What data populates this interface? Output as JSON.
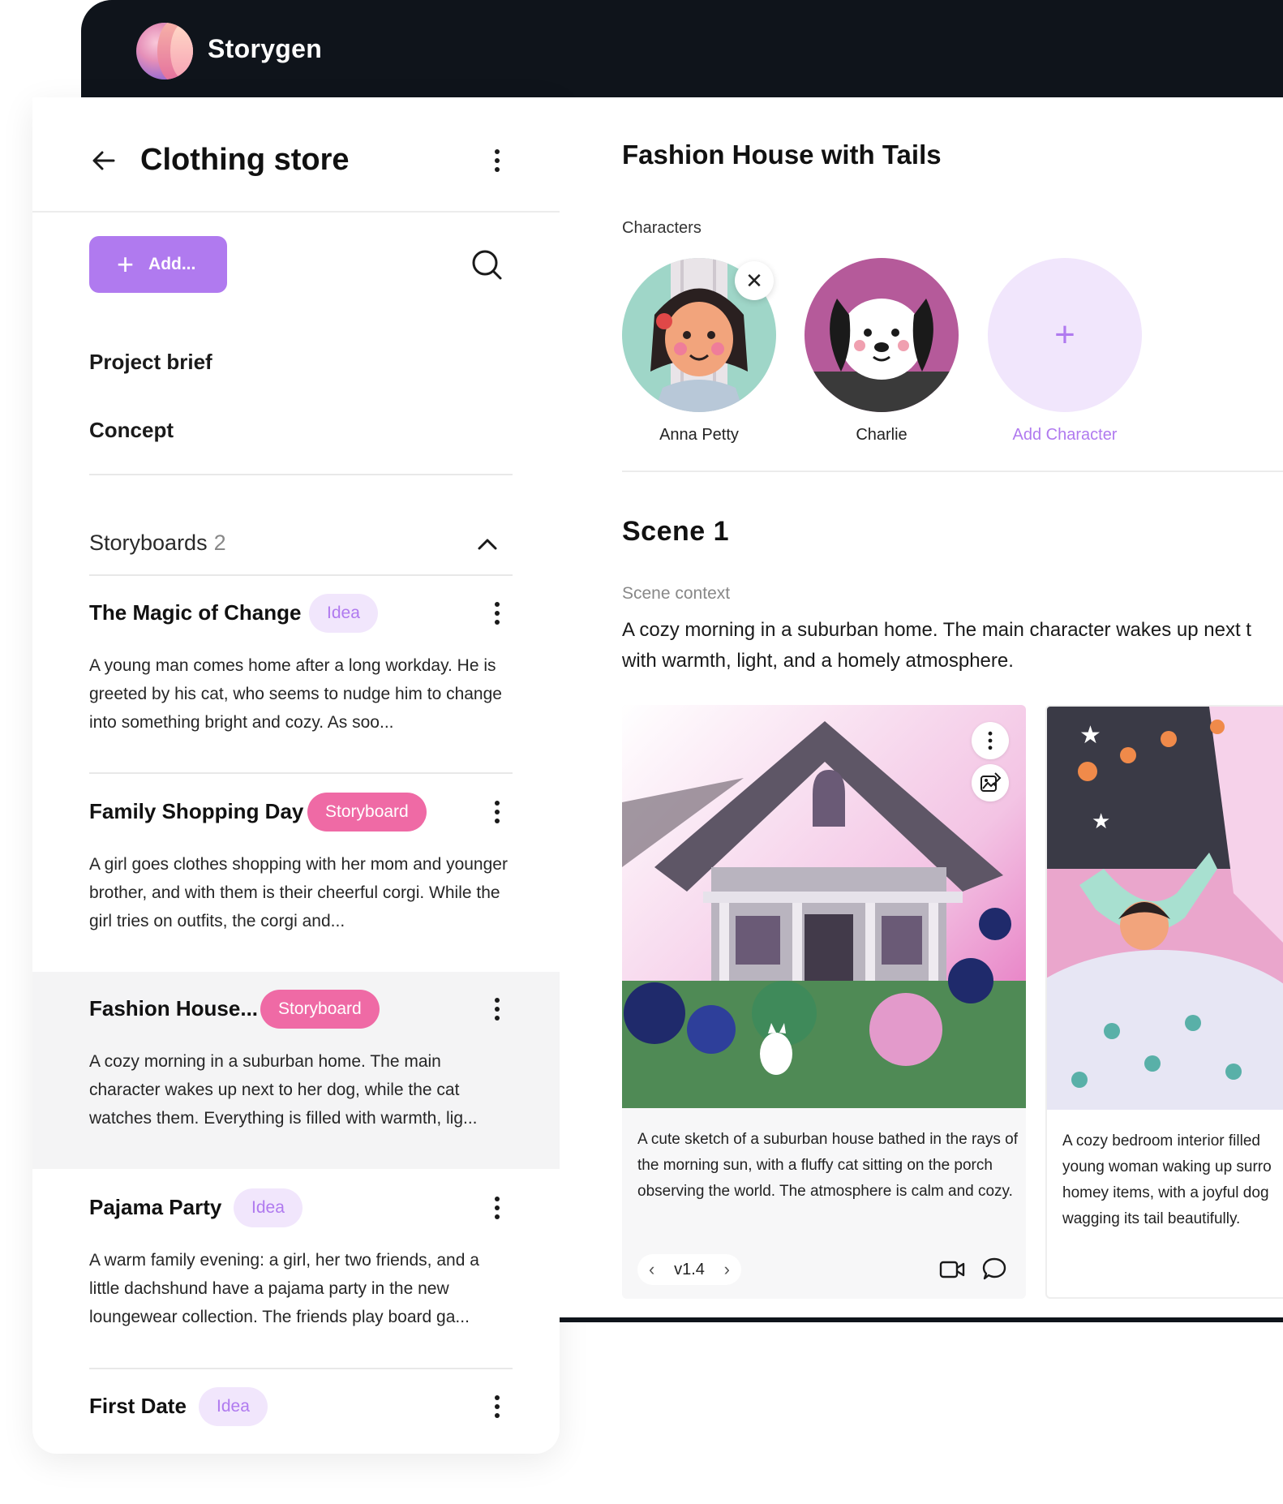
{
  "app": {
    "brand": "Storygen"
  },
  "sidebar": {
    "title": "Clothing store",
    "add_label": "Add...",
    "nav": [
      {
        "label": "Project brief"
      },
      {
        "label": "Concept"
      }
    ],
    "storyboards_label": "Storyboards",
    "storyboards_count": "2",
    "cards": [
      {
        "title": "The Magic of Change",
        "badge": "Idea",
        "body": "A young man comes home after a long workday. He is greeted by his cat, who seems to nudge him to change into something bright and cozy. As soo..."
      },
      {
        "title": "Family Shopping Day",
        "badge": "Storyboard",
        "body": "A girl goes clothes shopping with her mom and younger brother, and with them is their cheerful corgi. While the girl tries on outfits, the corgi and..."
      },
      {
        "title": "Fashion House...",
        "badge": "Storyboard",
        "body": "A cozy morning in a suburban home. The main character wakes up next to her dog, while the cat watches them. Everything is filled with warmth, lig..."
      },
      {
        "title": "Pajama Party",
        "badge": "Idea",
        "body": "A warm family evening: a girl, her two friends, and a little dachshund have a pajama party in the new loungewear collection. The friends play board ga..."
      },
      {
        "title": "First Date",
        "badge": "Idea",
        "body": ""
      }
    ]
  },
  "main": {
    "title": "Fashion House with Tails",
    "characters_label": "Characters",
    "characters": [
      {
        "name": "Anna Petty"
      },
      {
        "name": "Charlie"
      }
    ],
    "add_character_label": "Add Character",
    "scene": {
      "title": "Scene 1",
      "context_label": "Scene context",
      "context_line1": "A cozy morning in a suburban home. The main character wakes up next t",
      "context_line2": "with warmth, light, and a homely atmosphere."
    },
    "shots": [
      {
        "caption": "A cute sketch of a suburban house bathed in the rays of the morning sun, with a fluffy cat sitting on the porch observing the world. The atmosphere is calm and cozy.",
        "version": "v1.4"
      },
      {
        "caption": "A cozy bedroom interior filled young woman waking up surro homey items, with a joyful dog wagging its tail beautifully."
      }
    ]
  },
  "colors": {
    "accent": "#b07aef",
    "accent_light": "#f1e6fc",
    "pink": "#ef6aa5",
    "dark": "#0f141b"
  }
}
